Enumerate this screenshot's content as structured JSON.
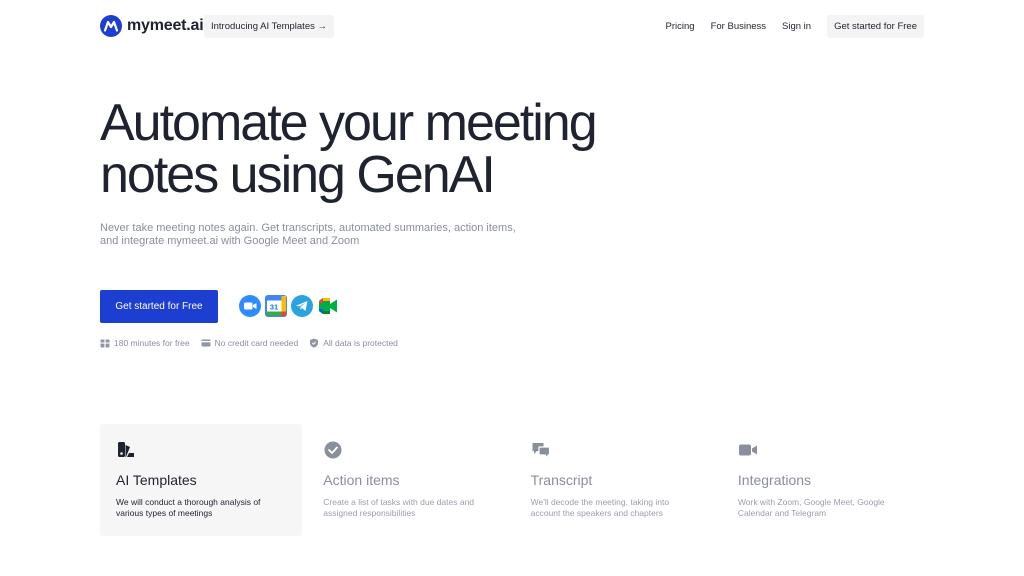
{
  "header": {
    "logo_text": "mymeet.ai",
    "announcement": "Introducing AI Templates →",
    "nav": [
      {
        "label": "Pricing"
      },
      {
        "label": "For Business"
      },
      {
        "label": "Sign in"
      }
    ],
    "cta": "Get started for Free"
  },
  "hero": {
    "title_line1": "Automate your meeting",
    "title_line2": "notes using GenAI",
    "subtitle_line1": "Never take meeting notes again. Get transcripts, automated summaries, action items,",
    "subtitle_line2": "and integrate mymeet.ai with Google Meet and Zoom",
    "cta": "Get started for Free",
    "integration_icons": [
      "zoom-icon",
      "google-calendar-icon",
      "telegram-icon",
      "google-meet-icon"
    ],
    "calendar_day": "31"
  },
  "perks": [
    {
      "icon": "gift-icon",
      "label": "180 minutes for free"
    },
    {
      "icon": "credit-card-icon",
      "label": "No credit card needed"
    },
    {
      "icon": "shield-icon",
      "label": "All data is protected"
    }
  ],
  "features": [
    {
      "icon": "templates-icon",
      "title": "AI Templates",
      "desc": "We will conduct a thorough analysis of various types of meetings",
      "active": true
    },
    {
      "icon": "check-badge-icon",
      "title": "Action items",
      "desc": "Create a list of tasks with due dates and assigned responsibilities",
      "active": false
    },
    {
      "icon": "chat-bubbles-icon",
      "title": "Transcript",
      "desc": "We'll decode the meeting, taking into account the speakers and chapters",
      "active": false
    },
    {
      "icon": "video-camera-icon",
      "title": "Integrations",
      "desc": "Work with Zoom, Google Meet, Google Calendar and Telegram",
      "active": false
    }
  ],
  "colors": {
    "primary": "#1d3fd1",
    "text": "#1f2330",
    "muted": "#8a8f9c",
    "chip_bg": "#f4f4f5",
    "card_active_bg": "#f6f6f7"
  }
}
